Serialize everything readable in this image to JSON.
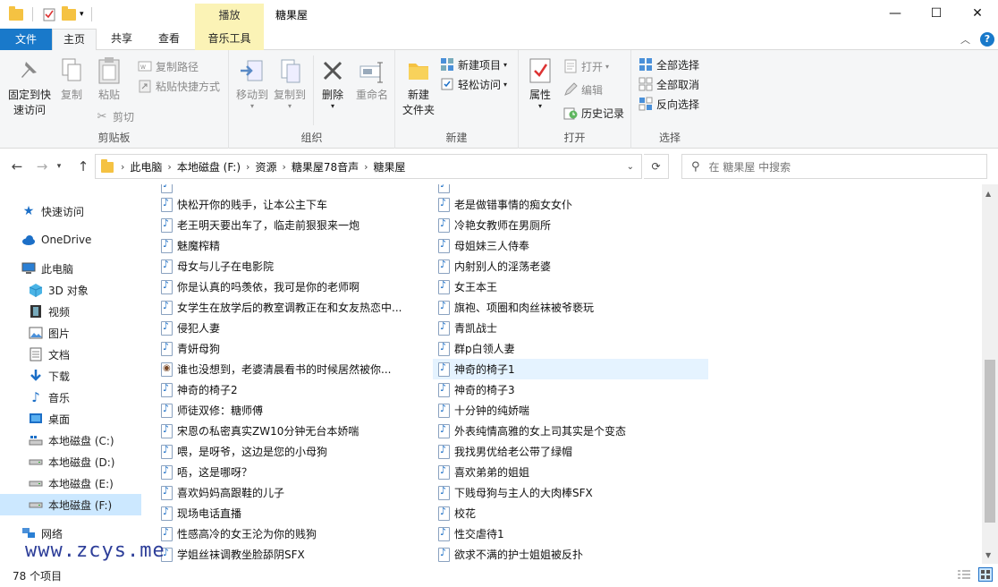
{
  "window": {
    "title": "糖果屋",
    "context_tab_group": "播放",
    "controls": {
      "minimize": "—",
      "maximize": "☐",
      "close": "✕"
    }
  },
  "tabs": {
    "file": "文件",
    "home": "主页",
    "share": "共享",
    "view": "查看",
    "music_tools": "音乐工具"
  },
  "ribbon": {
    "clipboard": {
      "label": "剪贴板",
      "pin": "固定到快速访问",
      "pin_line1": "固定到快",
      "pin_line2": "速访问",
      "copy": "复制",
      "paste": "粘贴",
      "copy_path": "复制路径",
      "paste_shortcut": "粘贴快捷方式",
      "cut": "剪切"
    },
    "organize": {
      "label": "组织",
      "move_to": "移动到",
      "copy_to": "复制到",
      "delete": "删除",
      "rename": "重命名"
    },
    "new": {
      "label": "新建",
      "new_folder_line1": "新建",
      "new_folder_line2": "文件夹",
      "new_item": "新建项目",
      "easy_access": "轻松访问"
    },
    "open": {
      "label": "打开",
      "properties": "属性",
      "open": "打开",
      "edit": "编辑",
      "history": "历史记录"
    },
    "select": {
      "label": "选择",
      "select_all": "全部选择",
      "select_none": "全部取消",
      "invert": "反向选择"
    }
  },
  "address": {
    "crumbs": [
      "此电脑",
      "本地磁盘 (F:)",
      "资源",
      "糖果屋78音声",
      "糖果屋"
    ],
    "search_placeholder": "在 糖果屋 中搜索"
  },
  "nav_pane": {
    "quick_access": "快速访问",
    "onedrive": "OneDrive",
    "this_pc": "此电脑",
    "objects3d": "3D 对象",
    "videos": "视频",
    "pictures": "图片",
    "documents": "文档",
    "downloads": "下载",
    "music": "音乐",
    "desktop": "桌面",
    "drive_c": "本地磁盘 (C:)",
    "drive_d": "本地磁盘 (D:)",
    "drive_e": "本地磁盘 (E:)",
    "drive_f": "本地磁盘 (F:)",
    "network": "网络"
  },
  "files_left": [
    "快松开你的贱手，让本公主下车",
    "老王明天要出车了，临走前狠狠来一炮",
    "魅魔榨精",
    "母女与儿子在电影院",
    "你是认真的吗羡依，我可是你的老师啊",
    "女学生在放学后的教室调教正在和女友热恋中...",
    "侵犯人妻",
    "青妍母狗",
    "谁也没想到，老婆清晨看书的时候居然被你...",
    "神奇的椅子2",
    "师徒双修：糖师傅",
    "宋恩の私密真实ZW10分钟无台本娇喘",
    "喂，是呀爷，这边是您的小母狗",
    "唔，这是哪呀？",
    "喜欢妈妈高跟鞋的儿子",
    "现场电话直播",
    "性感高冷的女王沦为你的贱狗",
    "学姐丝袜调教坐脸舔阴SFX"
  ],
  "files_right": [
    "老是做错事情的痴女女仆",
    "冷艳女教师在男厕所",
    "母姐妹三人侍奉",
    "内射别人的淫荡老婆",
    "女王本王",
    "旗袍、项圈和肉丝袜被爷亵玩",
    "青凯战士",
    "群p白领人妻",
    "神奇的椅子1",
    "神奇的椅子3",
    "十分钟的纯娇喘",
    "外表纯情高雅的女上司其实是个变态",
    "我找男优给老公带了绿帽",
    "喜欢弟弟的姐姐",
    "下贱母狗与主人的大肉棒SFX",
    "校花",
    "性交虐待1",
    "欲求不满的护士姐姐被反扑"
  ],
  "status": {
    "count": "78 个项目"
  },
  "watermark": "www.zcys.me",
  "colors": {
    "file_tab": "#1979ca",
    "context_tab": "#fbf3b6",
    "selected_nav": "#cce8ff",
    "accent_blue": "#1c6fc7"
  }
}
